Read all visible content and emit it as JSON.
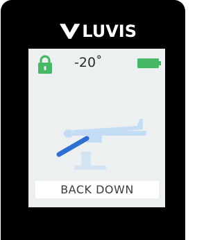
{
  "brand": {
    "name": "LUVIS"
  },
  "status_bar": {
    "lock_icon": "lock-icon",
    "temperature": "-20˚",
    "battery_icon": "battery-full-icon"
  },
  "mode": {
    "label": "BACK DOWN",
    "illustration": "table-back-down-illustration"
  },
  "colors": {
    "accent_green": "#46b866",
    "position_blue": "#2f6fd2",
    "table_light_blue": "#c5ddf4",
    "screen_bg": "#edf0f1",
    "bezel": "#000000"
  }
}
